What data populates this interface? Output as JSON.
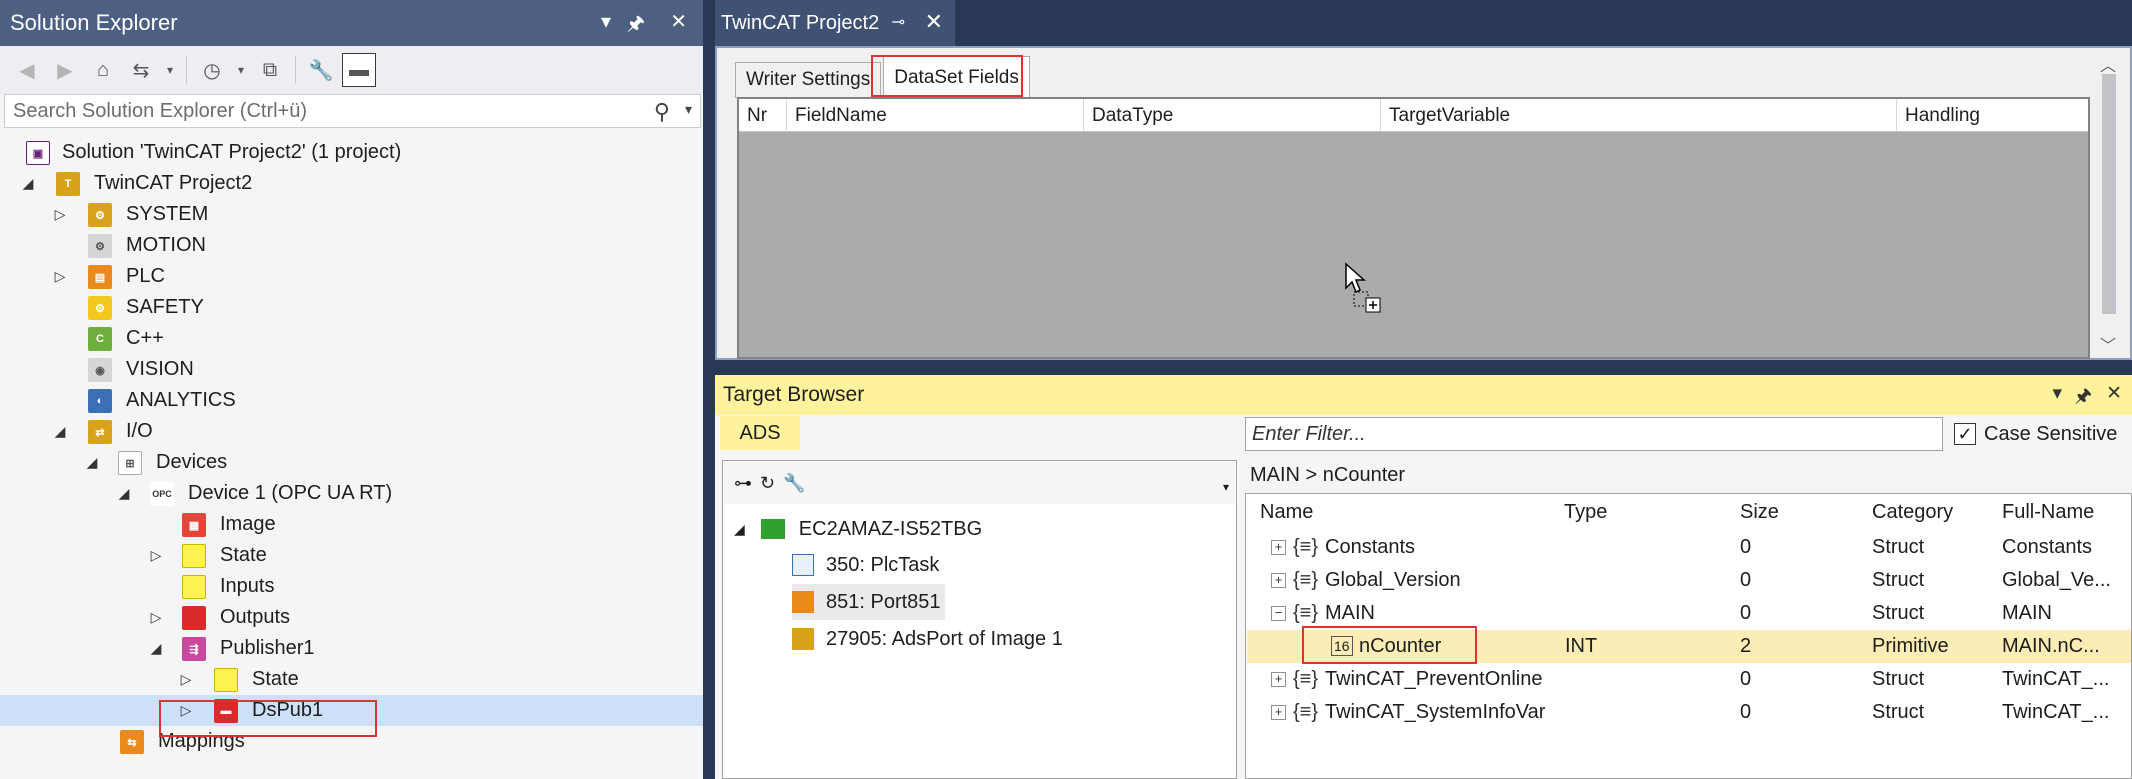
{
  "solution_explorer": {
    "title": "Solution Explorer",
    "search_placeholder": "Search Solution Explorer (Ctrl+ü)",
    "items": [
      {
        "label": "Solution 'TwinCAT Project2' (1 project)"
      },
      {
        "label": "TwinCAT Project2"
      },
      {
        "label": "SYSTEM"
      },
      {
        "label": "MOTION"
      },
      {
        "label": "PLC"
      },
      {
        "label": "SAFETY"
      },
      {
        "label": "C++"
      },
      {
        "label": "VISION"
      },
      {
        "label": "ANALYTICS"
      },
      {
        "label": "I/O"
      },
      {
        "label": "Devices"
      },
      {
        "label": "Device 1 (OPC UA RT)"
      },
      {
        "label": "Image"
      },
      {
        "label": "State"
      },
      {
        "label": "Inputs"
      },
      {
        "label": "Outputs"
      },
      {
        "label": "Publisher1"
      },
      {
        "label": "State"
      },
      {
        "label": "DsPub1"
      },
      {
        "label": "Mappings"
      }
    ]
  },
  "document": {
    "tab_title": "TwinCAT Project2",
    "tabs": [
      {
        "label": "Writer Settings"
      },
      {
        "label": "DataSet Fields"
      }
    ],
    "columns": [
      "Nr",
      "FieldName",
      "DataType",
      "TargetVariable",
      "Handling"
    ]
  },
  "target_browser": {
    "title": "Target Browser",
    "ads_tab": "ADS",
    "filter_placeholder": "Enter Filter...",
    "case_sensitive_label": "Case Sensitive",
    "case_sensitive_checked": true,
    "tree": [
      {
        "label": "EC2AMAZ-IS52TBG"
      },
      {
        "label": "350: PlcTask"
      },
      {
        "label": "851: Port851"
      },
      {
        "label": "27905: AdsPort of Image 1"
      }
    ],
    "breadcrumb": "MAIN > nCounter",
    "columns": [
      "Name",
      "Type",
      "Size",
      "Category",
      "Full-Name"
    ],
    "rows": [
      {
        "name": "Constants",
        "type": "",
        "size": "0",
        "category": "Struct",
        "full": "Constants"
      },
      {
        "name": "Global_Version",
        "type": "",
        "size": "0",
        "category": "Struct",
        "full": "Global_Ve..."
      },
      {
        "name": "MAIN",
        "type": "",
        "size": "0",
        "category": "Struct",
        "full": "MAIN"
      },
      {
        "name": "nCounter",
        "type": "INT",
        "size": "2",
        "category": "Primitive",
        "full": "MAIN.nC..."
      },
      {
        "name": "TwinCAT_PreventOnline",
        "type": "",
        "size": "0",
        "category": "Struct",
        "full": "TwinCAT_..."
      },
      {
        "name": "TwinCAT_SystemInfoVar",
        "type": "",
        "size": "0",
        "category": "Struct",
        "full": "TwinCAT_..."
      }
    ]
  },
  "colors": {
    "accent": "#4d6082",
    "highlight": "#e03030",
    "tool_window_title": "#fff29d"
  }
}
